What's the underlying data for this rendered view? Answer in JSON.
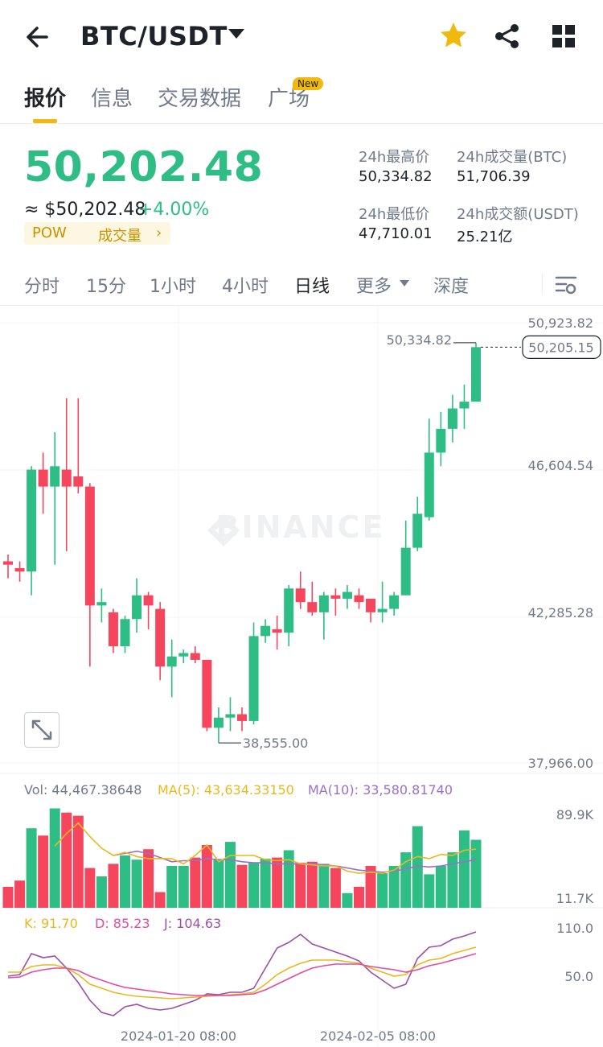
{
  "header": {
    "pair": "BTC/USDT",
    "icons": [
      "back-arrow-icon",
      "caret-down-icon",
      "star-icon",
      "share-icon",
      "grid-icon"
    ]
  },
  "tabs": [
    {
      "label": "报价",
      "active": true
    },
    {
      "label": "信息",
      "active": false
    },
    {
      "label": "交易数据",
      "active": false
    },
    {
      "label": "广场",
      "active": false,
      "badge": "New"
    }
  ],
  "price": {
    "last": "50,202.48",
    "approx": "≈ $50,202.48",
    "change": "+4.00%",
    "tags": [
      "POW",
      "成交量"
    ]
  },
  "stats": {
    "high_label": "24h最高价",
    "high": "50,334.82",
    "vol_btc_label": "24h成交量(BTC)",
    "vol_btc": "51,706.39",
    "low_label": "24h最低价",
    "low": "47,710.01",
    "vol_usdt_label": "24h成交额(USDT)",
    "vol_usdt": "25.21亿"
  },
  "intervals": [
    {
      "label": "分时",
      "active": false
    },
    {
      "label": "15分",
      "active": false
    },
    {
      "label": "1小时",
      "active": false
    },
    {
      "label": "4小时",
      "active": false
    },
    {
      "label": "日线",
      "active": true
    },
    {
      "label": "更多",
      "active": false
    },
    {
      "label": "深度",
      "active": false
    }
  ],
  "colors": {
    "up": "#2ebd85",
    "down": "#f6465d",
    "accent": "#f0b90b",
    "ma5": "#e8b91e",
    "ma10": "#9c6fc7",
    "j": "#9c4fa9",
    "d": "#e24ba3"
  },
  "chart_data": {
    "type": "candlestick",
    "watermark": "BINANCE",
    "price_axis": [
      "50,923.82",
      "46,604.54",
      "42,285.28",
      "37,966.00"
    ],
    "price_range": [
      37966.0,
      50923.82
    ],
    "current_price_tag": "50,205.15",
    "max_label": "50,334.82",
    "min_label": "38,555.00",
    "candles": [
      [
        43900,
        44100,
        43400,
        43800
      ],
      [
        43700,
        43900,
        43300,
        43600
      ],
      [
        43600,
        46700,
        42900,
        46600
      ],
      [
        46600,
        47100,
        45300,
        46100
      ],
      [
        46100,
        47700,
        43800,
        46700
      ],
      [
        46600,
        48700,
        44200,
        46100
      ],
      [
        46400,
        48700,
        45900,
        46100
      ],
      [
        46100,
        46200,
        40800,
        42600
      ],
      [
        42600,
        43100,
        42100,
        42700
      ],
      [
        42400,
        42500,
        41200,
        41400
      ],
      [
        41400,
        42300,
        41200,
        42200
      ],
      [
        42200,
        43400,
        41800,
        42900
      ],
      [
        42900,
        43000,
        41900,
        42600
      ],
      [
        42500,
        42700,
        40400,
        40800
      ],
      [
        40800,
        41600,
        39900,
        41100
      ],
      [
        41100,
        41300,
        40900,
        41200
      ],
      [
        41200,
        41400,
        40900,
        41000
      ],
      [
        41000,
        41000,
        38900,
        39000
      ],
      [
        39000,
        39600,
        38555,
        39300
      ],
      [
        39300,
        39900,
        38900,
        39400
      ],
      [
        39400,
        39600,
        38900,
        39200
      ],
      [
        39200,
        42100,
        39100,
        41700
      ],
      [
        41700,
        42200,
        41500,
        42000
      ],
      [
        41900,
        42300,
        41300,
        41800
      ],
      [
        41800,
        43200,
        41400,
        43100
      ],
      [
        43100,
        43600,
        42500,
        42700
      ],
      [
        42700,
        43300,
        42300,
        42400
      ],
      [
        42400,
        43000,
        41600,
        42900
      ],
      [
        42900,
        43100,
        42300,
        42800
      ],
      [
        42800,
        43200,
        42500,
        43000
      ],
      [
        42900,
        43100,
        42500,
        42700
      ],
      [
        42800,
        42800,
        42100,
        42400
      ],
      [
        42400,
        43300,
        42100,
        42500
      ],
      [
        42500,
        43000,
        42300,
        42900
      ],
      [
        42900,
        45100,
        42900,
        44300
      ],
      [
        44300,
        45800,
        44200,
        45300
      ],
      [
        45200,
        48100,
        45100,
        47100
      ],
      [
        47100,
        48300,
        46700,
        47800
      ],
      [
        47800,
        48800,
        47400,
        48400
      ],
      [
        48400,
        49100,
        47800,
        48600
      ],
      [
        48600,
        50334,
        48600,
        50205
      ]
    ],
    "volume": {
      "label": "Vol: 44,467.38648",
      "ma5_label": "MA(5): 43,634.33150",
      "ma10_label": "MA(10): 33,580.81740",
      "axis": [
        "89.9K",
        "11.7K"
      ],
      "values": [
        20,
        26,
        76,
        69,
        95,
        91,
        88,
        38,
        30,
        42,
        50,
        46,
        56,
        15,
        40,
        40,
        48,
        60,
        46,
        63,
        41,
        43,
        47,
        48,
        55,
        43,
        44,
        42,
        38,
        14,
        20,
        40,
        33,
        40,
        53,
        78,
        32,
        40,
        53,
        74,
        65
      ],
      "ma5": [
        null,
        null,
        null,
        null,
        59,
        71,
        81,
        68,
        57,
        50,
        53,
        49,
        47,
        47,
        47,
        42,
        50,
        60,
        44,
        50,
        50,
        50,
        46,
        45,
        46,
        42,
        41,
        40,
        40,
        35,
        33,
        34,
        33,
        36,
        44,
        49,
        47,
        51,
        50,
        55,
        56
      ],
      "ma10": [
        null,
        null,
        null,
        null,
        null,
        null,
        null,
        null,
        null,
        50,
        52,
        54,
        52,
        48,
        44,
        45,
        45,
        47,
        46,
        46,
        44,
        43,
        43,
        42,
        42,
        42,
        42,
        41,
        40,
        38,
        36,
        35,
        34,
        35,
        37,
        40,
        39,
        40,
        42,
        44,
        46
      ]
    },
    "kdj": {
      "k_label": "K: 91.70",
      "d_label": "D: 85.23",
      "j_label": "J: 104.63",
      "axis": [
        "110.0",
        "50.0"
      ],
      "k": [
        55,
        55,
        62,
        64,
        64,
        60,
        52,
        40,
        35,
        30,
        27,
        25,
        24,
        23,
        22,
        23,
        24,
        25,
        26,
        27,
        28,
        30,
        40,
        52,
        60,
        66,
        70,
        70,
        70,
        68,
        66,
        60,
        55,
        50,
        52,
        64,
        70,
        72,
        78,
        82,
        86
      ],
      "d": [
        48,
        49,
        55,
        58,
        60,
        60,
        57,
        50,
        45,
        40,
        36,
        34,
        32,
        30,
        28,
        27,
        26,
        26,
        26,
        26,
        27,
        28,
        33,
        40,
        47,
        54,
        60,
        63,
        65,
        65,
        65,
        62,
        60,
        58,
        55,
        58,
        63,
        66,
        70,
        74,
        78
      ],
      "j": [
        50,
        52,
        78,
        73,
        75,
        60,
        42,
        20,
        5,
        1,
        12,
        15,
        10,
        8,
        10,
        15,
        20,
        28,
        27,
        30,
        30,
        35,
        60,
        85,
        92,
        102,
        90,
        85,
        80,
        75,
        69,
        55,
        45,
        35,
        40,
        72,
        86,
        88,
        96,
        100,
        105
      ]
    },
    "x_axis": [
      "2024-01-20 08:00",
      "2024-02-05 08:00"
    ]
  }
}
